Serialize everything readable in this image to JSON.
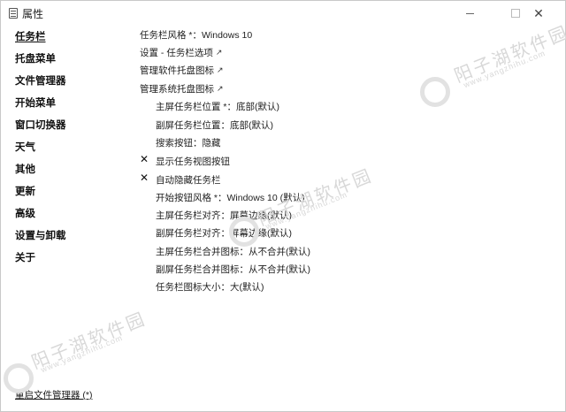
{
  "window": {
    "title": "属性",
    "minimize_icon": "minimize-icon",
    "maximize_icon": "maximize-icon",
    "close_icon": "close-icon"
  },
  "sidebar": {
    "items": [
      {
        "label": "任务栏",
        "active": true
      },
      {
        "label": "托盘菜单"
      },
      {
        "label": "文件管理器"
      },
      {
        "label": "开始菜单"
      },
      {
        "label": "窗口切换器"
      },
      {
        "label": "天气"
      },
      {
        "label": "其他"
      },
      {
        "label": "更新"
      },
      {
        "label": "高级"
      },
      {
        "label": "设置与卸载"
      },
      {
        "label": "关于"
      }
    ]
  },
  "settings": {
    "rows": [
      {
        "label": "任务栏风格 *：Windows 10"
      },
      {
        "label": "设置 - 任务栏选项",
        "link": true
      },
      {
        "label": "管理软件托盘图标",
        "link": true
      },
      {
        "label": "管理系统托盘图标",
        "link": true
      },
      {
        "label": "主屏任务栏位置 *：底部(默认)"
      },
      {
        "label": "副屏任务栏位置：底部(默认)"
      },
      {
        "label": "搜索按钮：隐藏"
      },
      {
        "label": "显示任务视图按钮",
        "checked": false
      },
      {
        "label": "自动隐藏任务栏",
        "checked": false
      },
      {
        "label": "开始按钮风格 *：Windows 10 (默认)"
      },
      {
        "label": "主屏任务栏对齐：屏幕边缘(默认)"
      },
      {
        "label": "副屏任务栏对齐：屏幕边缘(默认)"
      },
      {
        "label": "主屏任务栏合并图标：从不合并(默认)"
      },
      {
        "label": "副屏任务栏合并图标：从不合并(默认)"
      },
      {
        "label": "任务栏图标大小：大(默认)"
      }
    ],
    "link_arrow": "↗",
    "unchecked_mark": "✕"
  },
  "footer": {
    "restart_link": "重启文件管理器 (*)"
  },
  "watermark": {
    "text": "阳子湖软件园",
    "url": "www.yangzhihu.com"
  }
}
